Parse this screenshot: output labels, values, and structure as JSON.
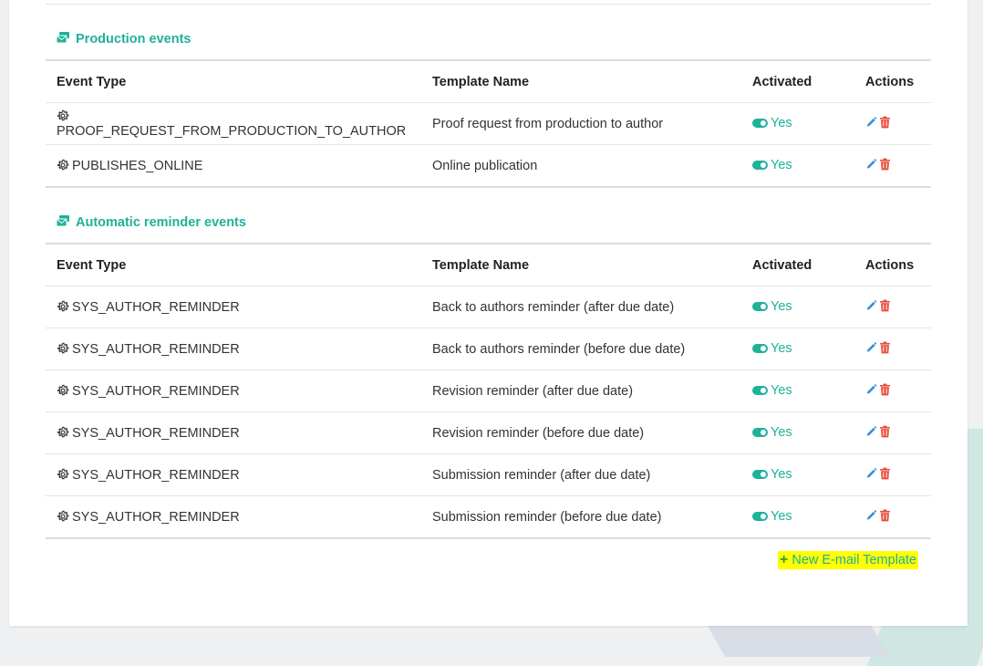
{
  "sections": [
    {
      "title": "Production events",
      "headers": {
        "event_type": "Event Type",
        "template_name": "Template Name",
        "activated": "Activated",
        "actions": "Actions"
      },
      "rows": [
        {
          "event": "PROOF_REQUEST_FROM_PRODUCTION_TO_AUTHOR",
          "template": "Proof request from production to author",
          "activated": "Yes"
        },
        {
          "event": "PUBLISHES_ONLINE",
          "template": "Online publication",
          "activated": "Yes"
        }
      ]
    },
    {
      "title": "Automatic reminder events",
      "headers": {
        "event_type": "Event Type",
        "template_name": "Template Name",
        "activated": "Activated",
        "actions": "Actions"
      },
      "rows": [
        {
          "event": "SYS_AUTHOR_REMINDER",
          "template": "Back to authors reminder (after due date)",
          "activated": "Yes"
        },
        {
          "event": "SYS_AUTHOR_REMINDER",
          "template": "Back to authors reminder (before due date)",
          "activated": "Yes"
        },
        {
          "event": "SYS_AUTHOR_REMINDER",
          "template": "Revision reminder (after due date)",
          "activated": "Yes"
        },
        {
          "event": "SYS_AUTHOR_REMINDER",
          "template": "Revision reminder (before due date)",
          "activated": "Yes"
        },
        {
          "event": "SYS_AUTHOR_REMINDER",
          "template": "Submission reminder (after due date)",
          "activated": "Yes"
        },
        {
          "event": "SYS_AUTHOR_REMINDER",
          "template": "Submission reminder (before due date)",
          "activated": "Yes"
        }
      ]
    }
  ],
  "new_template_label": "New E-mail Template",
  "icons": {
    "section": "envelopes-icon",
    "event": "gear-icon",
    "status": "toggle-on-icon",
    "edit": "pencil-icon",
    "delete": "trash-icon",
    "add": "plus-icon"
  },
  "colors": {
    "accent": "#1fb19a",
    "edit": "#3a8fd8",
    "delete": "#e74c3c",
    "highlight": "#ffff00"
  }
}
